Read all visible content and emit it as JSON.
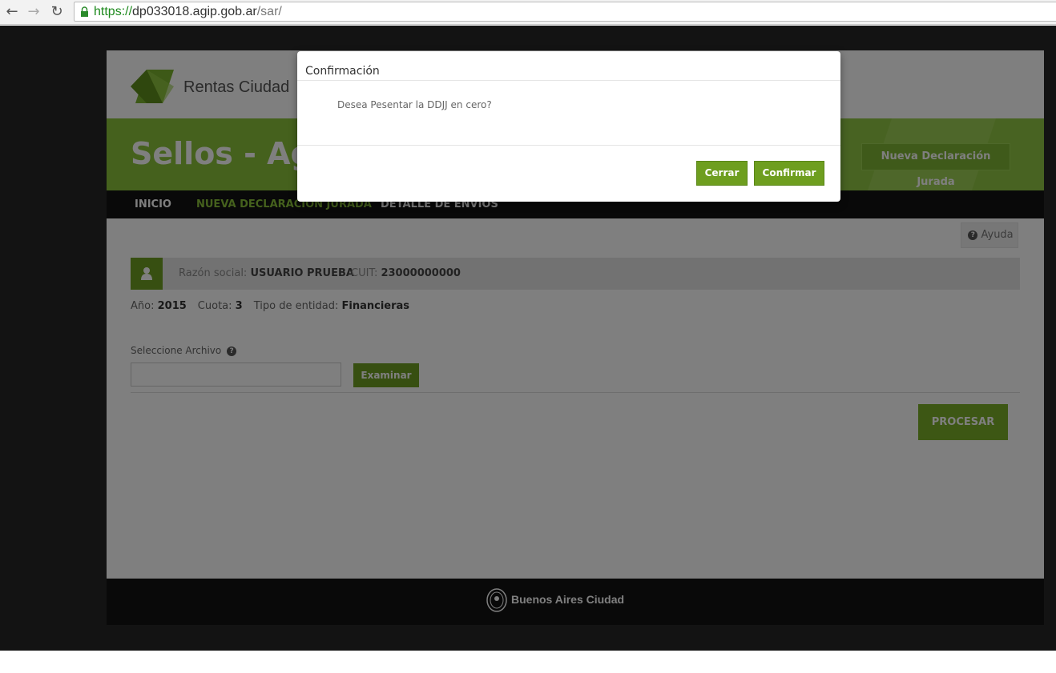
{
  "browser": {
    "url_scheme": "https://",
    "url_host": "dp033018.agip.gob.ar",
    "url_path": "/sar/",
    "back_icon": "arrow-left-icon",
    "forward_icon": "arrow-right-icon",
    "reload_icon": "reload-icon"
  },
  "header": {
    "logo_text": "Rentas Ciudad"
  },
  "banner": {
    "title": "Sellos - Ag",
    "action_button": "Nueva Declaración Jurada"
  },
  "nav": {
    "items": [
      "INICIO",
      "NUEVA DECLARACION JURADA",
      "DETALLE DE ENVIOS"
    ]
  },
  "content": {
    "ayuda_label": "Ayuda",
    "razon_social_label": "Razón social:",
    "razon_social_value": "USUARIO PRUEBA",
    "cuit_label": "CUIT:",
    "cuit_value": "23000000000",
    "anio_label": "Año:",
    "anio_value": "2015",
    "cuota_label": "Cuota:",
    "cuota_value": "3",
    "tipo_entidad_label": "Tipo de entidad:",
    "tipo_entidad_value": "Financieras",
    "file_label": "Seleccione Archivo",
    "file_value": "",
    "examinar_label": "Examinar",
    "procesar_label": "PROCESAR"
  },
  "footer": {
    "text": "Buenos Aires Ciudad"
  },
  "modal": {
    "title": "Confirmación",
    "message": "Desea Pesentar la DDJJ en cero?",
    "cerrar_label": "Cerrar",
    "confirmar_label": "Confirmar"
  },
  "colors": {
    "brand_green": "#8ac33a",
    "button_green": "#6e9e1f",
    "dark_background": "#262626"
  }
}
